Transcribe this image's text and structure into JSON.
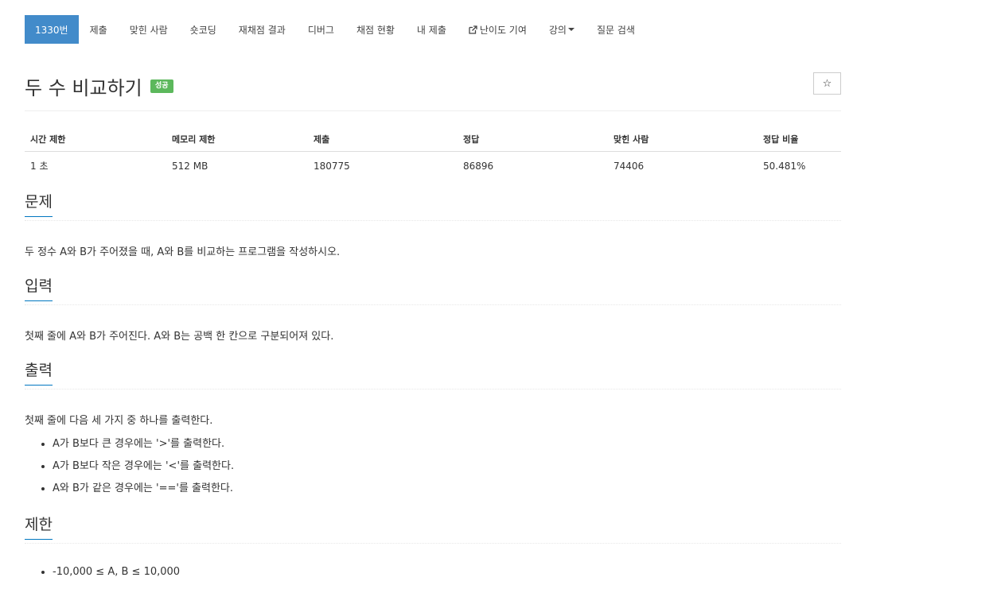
{
  "nav": {
    "items": [
      {
        "label": "1330번",
        "active": true
      },
      {
        "label": "제출"
      },
      {
        "label": "맞힌 사람"
      },
      {
        "label": "숏코딩"
      },
      {
        "label": "재채점 결과"
      },
      {
        "label": "디버그"
      },
      {
        "label": "채점 현황"
      },
      {
        "label": "내 제출"
      },
      {
        "label": "난이도 기여",
        "icon": "external-link-icon"
      },
      {
        "label": "강의",
        "icon": "caret-down-icon"
      },
      {
        "label": "질문 검색"
      }
    ]
  },
  "header": {
    "title": "두 수 비교하기",
    "badge": "성공",
    "star": "☆"
  },
  "info": {
    "headers": [
      "시간 제한",
      "메모리 제한",
      "제출",
      "정답",
      "맞힌 사람",
      "정답 비율"
    ],
    "values": [
      "1 초",
      "512 MB",
      "180775",
      "86896",
      "74406",
      "50.481%"
    ]
  },
  "sections": {
    "problem": {
      "title": "문제",
      "text": "두 정수 A와 B가 주어졌을 때, A와 B를 비교하는 프로그램을 작성하시오."
    },
    "input": {
      "title": "입력",
      "text": "첫째 줄에 A와 B가 주어진다. A와 B는 공백 한 칸으로 구분되어져 있다."
    },
    "output": {
      "title": "출력",
      "text": "첫째 줄에 다음 세 가지 중 하나를 출력한다.",
      "items": [
        "A가 B보다 큰 경우에는 '>'를 출력한다.",
        "A가 B보다 작은 경우에는 '<'를 출력한다.",
        "A와 B가 같은 경우에는 '=='를 출력한다."
      ]
    },
    "limit": {
      "title": "제한",
      "items": [
        "-10,000 ≤ A, B ≤ 10,000"
      ]
    }
  },
  "colors": {
    "nav_active": "#428bca",
    "badge_success": "#5cb85c",
    "section_underline": "#0076c0"
  }
}
